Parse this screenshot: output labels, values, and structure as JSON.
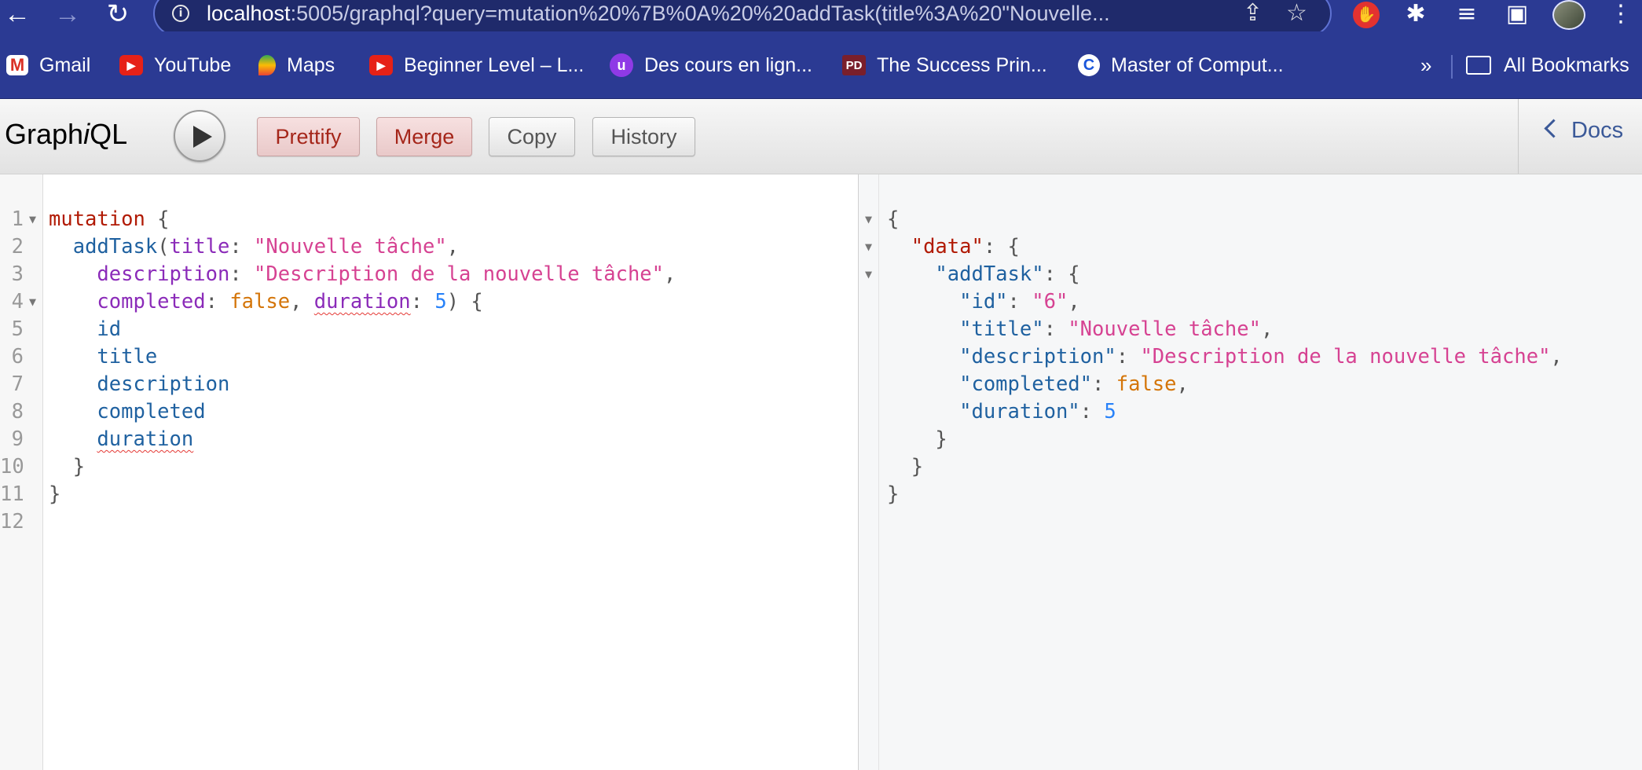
{
  "browser": {
    "url_host": "localhost",
    "url_rest": ":5005/graphql?query=mutation%20%7B%0A%20%20addTask(title%3A%20\"Nouvelle...",
    "bookmarks": [
      {
        "label": "Gmail"
      },
      {
        "label": "YouTube"
      },
      {
        "label": "Maps"
      },
      {
        "label": "Beginner Level – L..."
      },
      {
        "label": "Des cours en lign..."
      },
      {
        "label": "The Success Prin..."
      },
      {
        "label": "Master of Comput..."
      }
    ],
    "overflow_label": "»",
    "all_bookmarks_label": "All Bookmarks"
  },
  "toolbar": {
    "logo_pre": "Graph",
    "logo_i": "i",
    "logo_post": "QL",
    "prettify_label": "Prettify",
    "merge_label": "Merge",
    "copy_label": "Copy",
    "history_label": "History",
    "docs_label": "Docs"
  },
  "editor": {
    "line_numbers": [
      "1",
      "2",
      "3",
      "4",
      "5",
      "6",
      "7",
      "8",
      "9",
      "10",
      "11",
      "12"
    ],
    "tokens": {
      "mutation": "mutation",
      "addTask": "addTask",
      "title_arg": "title",
      "title_val": "\"Nouvelle tâche\"",
      "desc_arg": "description",
      "desc_val": "\"Description de la nouvelle tâche\"",
      "completed_arg": "completed",
      "completed_val": "false",
      "duration_arg": "duration",
      "duration_val": "5",
      "f_id": "id",
      "f_title": "title",
      "f_description": "description",
      "f_completed": "completed",
      "f_duration": "duration"
    }
  },
  "result": {
    "data_key": "\"data\"",
    "addTask_key": "\"addTask\"",
    "id_key": "\"id\"",
    "id_val": "\"6\"",
    "title_key": "\"title\"",
    "title_val": "\"Nouvelle tâche\"",
    "description_key": "\"description\"",
    "description_val": "\"Description de la nouvelle tâche\"",
    "completed_key": "\"completed\"",
    "completed_val": "false",
    "duration_key": "\"duration\"",
    "duration_val": "5"
  }
}
